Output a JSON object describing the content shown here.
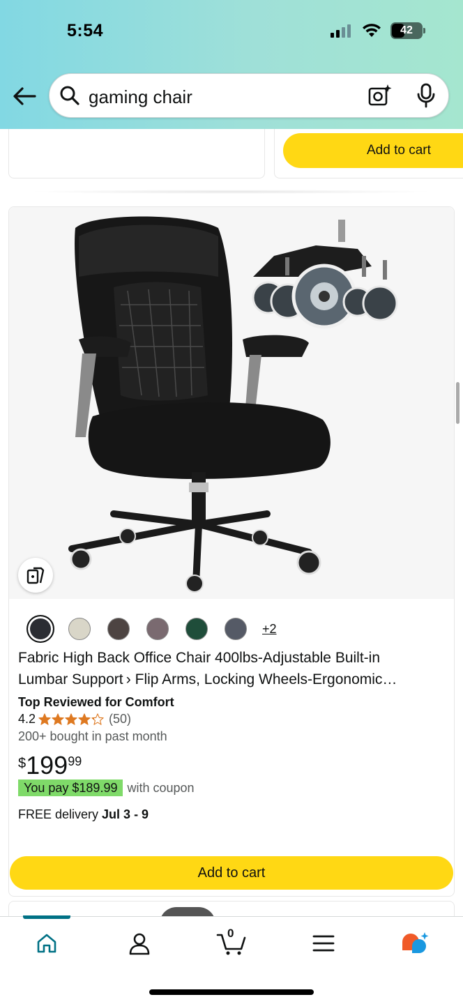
{
  "status_bar": {
    "time": "5:54",
    "battery": "42"
  },
  "search": {
    "query": "gaming chair"
  },
  "previous_item": {
    "add_to_cart_label": "Add to cart"
  },
  "product": {
    "swatch_colors": [
      "#2b2d33",
      "#d9d6c8",
      "#4d4442",
      "#7a6a70",
      "#1f4d3a",
      "#555a66"
    ],
    "more_colors": "+2",
    "title_line1": "Fabric High Back Office Chair 400lbs-Adjustable Built-in",
    "title_line2": "Lumbar Support › Flip Arms, Locking Wheels-Ergonomic…",
    "badge": "Top Reviewed for Comfort",
    "rating": "4.2",
    "rating_stars": 4.2,
    "review_count": "(50)",
    "bought": "200+ bought in past month",
    "price_symbol": "$",
    "price_whole": "199",
    "price_fraction": "99",
    "coupon_label": "You pay $189.99",
    "coupon_suffix": "with coupon",
    "delivery_prefix": "FREE delivery ",
    "delivery_date": "Jul 3 - 9",
    "add_to_cart_label": "Add to cart"
  },
  "bottom_nav": {
    "items": [
      "home-icon",
      "account-icon",
      "cart-icon",
      "menu-icon",
      "rufus-icon"
    ],
    "cart_count": "0",
    "active": "home"
  },
  "colors": {
    "accent": "#007185",
    "cart_button": "#ffd814",
    "coupon": "#7fda69",
    "star": "#de7921"
  }
}
